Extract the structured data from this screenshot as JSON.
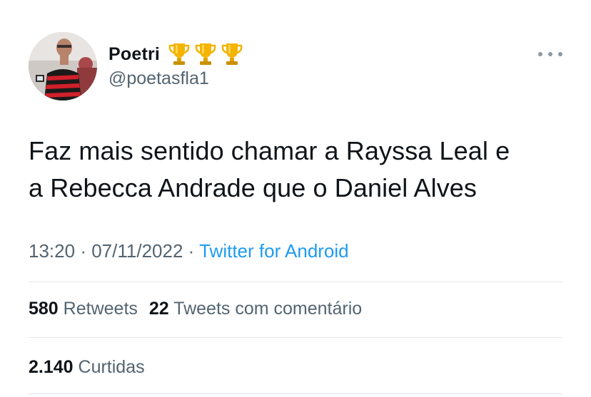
{
  "user": {
    "display_name": "Poetri",
    "handle": "@poetasfla1",
    "name_emoji": [
      "trophy-icon",
      "trophy-icon",
      "trophy-icon"
    ]
  },
  "tweet": {
    "text_lines": [
      "Faz mais sentido chamar a Rayssa Leal e",
      "a Rebecca Andrade que o Daniel Alves"
    ],
    "time": "13:20",
    "separator": "·",
    "date": "07/11/2022",
    "source": "Twitter for Android"
  },
  "stats": {
    "retweets_count": "580",
    "retweets_label": "Retweets",
    "quotes_count": "22",
    "quotes_label": "Tweets com comentário",
    "likes_count": "2.140",
    "likes_label": "Curtidas"
  },
  "colors": {
    "text_primary": "#0f1419",
    "text_secondary": "#536471",
    "link": "#1d9bf0",
    "divider": "#e1e6ea",
    "trophy_gold": "#f4b400"
  }
}
